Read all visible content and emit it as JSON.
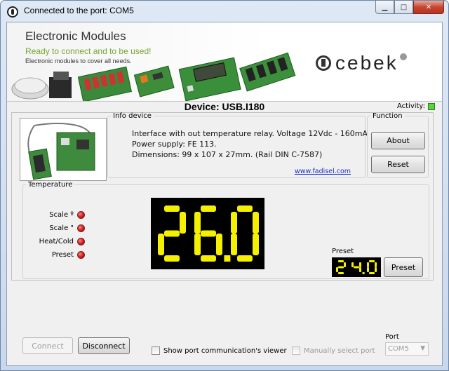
{
  "window": {
    "title": "Connected to the port: COM5"
  },
  "banner": {
    "title": "Electronic Modules",
    "subtitle": "Ready to connect and to be used!",
    "tagline": "Electronic modules to cover all needs.",
    "brand": "cebek"
  },
  "device": {
    "title": "Device: USB.I180",
    "activity_label": "Activity:",
    "activity_color": "#5ad33a"
  },
  "info": {
    "legend": "Info device",
    "line1": "Interface with out temperature relay.   Voltage 12Vdc - 160mA",
    "line2": "Power supply: FE 113.",
    "line3": "Dimensions: 99 x 107 x 27mm. (Rail DIN C-7587)",
    "link": "www.fadisel.com"
  },
  "function": {
    "legend": "Function",
    "about_label": "About",
    "reset_label": "Reset"
  },
  "temperature": {
    "legend": "Temperature",
    "indicators": [
      {
        "label": "Scale º",
        "color": "#d11a1a"
      },
      {
        "label": "Scale \"",
        "color": "#d11a1a"
      },
      {
        "label": "Heat/Cold",
        "color": "#d11a1a"
      },
      {
        "label": "Preset",
        "color": "#d11a1a"
      }
    ],
    "display_value": "26.0",
    "display_color": "#f5f000",
    "preset_label": "Preset",
    "preset_value": "24.0",
    "preset_button": "Preset"
  },
  "bottom": {
    "connect_label": "Connect",
    "disconnect_label": "Disconnect",
    "viewer_label": "Show port communication's viewer",
    "manual_label": "Manually select port",
    "port_label": "Port",
    "port_value": "COM5"
  },
  "icons": [
    "app-icon",
    "minimize-icon",
    "maximize-icon",
    "close-icon",
    "dropdown-arrow-icon"
  ]
}
